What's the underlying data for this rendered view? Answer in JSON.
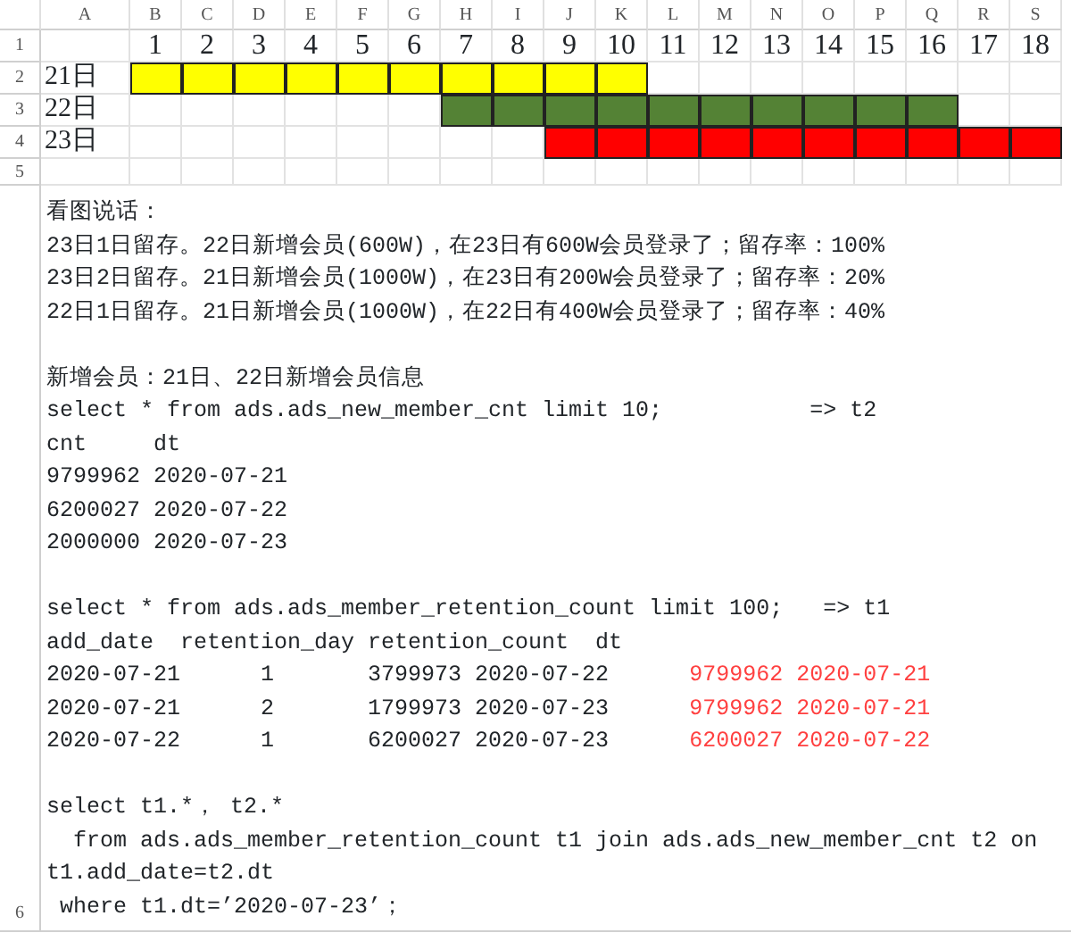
{
  "sheet": {
    "column_letters": [
      "A",
      "B",
      "C",
      "D",
      "E",
      "F",
      "G",
      "H",
      "I",
      "J",
      "K",
      "L",
      "M",
      "N",
      "O",
      "P",
      "Q",
      "R",
      "S"
    ],
    "row_numbers": [
      "1",
      "2",
      "3",
      "4",
      "5",
      "6"
    ],
    "day_numbers": [
      "1",
      "2",
      "3",
      "4",
      "5",
      "6",
      "7",
      "8",
      "9",
      "10",
      "11",
      "12",
      "13",
      "14",
      "15",
      "16",
      "17",
      "18"
    ],
    "rows": [
      {
        "label": "21日",
        "color": "#ffff00",
        "filled": [
          true,
          true,
          true,
          true,
          true,
          true,
          true,
          true,
          true,
          true,
          false,
          false,
          false,
          false,
          false,
          false,
          false,
          false
        ]
      },
      {
        "label": "22日",
        "color": "#548235",
        "filled": [
          false,
          false,
          false,
          false,
          false,
          false,
          true,
          true,
          true,
          true,
          true,
          true,
          true,
          true,
          true,
          true,
          false,
          false
        ]
      },
      {
        "label": "23日",
        "color": "#ff0000",
        "filled": [
          false,
          false,
          false,
          false,
          false,
          false,
          false,
          false,
          true,
          true,
          true,
          true,
          true,
          true,
          true,
          true,
          true,
          true
        ]
      }
    ],
    "note_blocks": [
      {
        "lines": [
          {
            "text": "看图说话："
          },
          {
            "text": "23日1日留存。22日新增会员(600W)，在23日有600W会员登录了；留存率：100%"
          },
          {
            "text": "23日2日留存。21日新增会员(1000W)，在23日有200W会员登录了；留存率：20%"
          },
          {
            "text": "22日1日留存。21日新增会员(1000W)，在22日有400W会员登录了；留存率：40%"
          }
        ]
      },
      {
        "lines": [
          {
            "text": "新增会员：21日、22日新增会员信息"
          },
          {
            "text": "select * from ads.ads_new_member_cnt limit 10;           => t2"
          },
          {
            "text": "cnt     dt"
          },
          {
            "text": "9799962 2020-07-21"
          },
          {
            "text": "6200027 2020-07-22"
          },
          {
            "text": "2000000 2020-07-23"
          }
        ]
      },
      {
        "lines": [
          {
            "text": "select * from ads.ads_member_retention_count limit 100;   => t1"
          },
          {
            "text": "add_date  retention_day retention_count  dt"
          },
          {
            "text": "2020-07-21      1       3799973 2020-07-22",
            "extra": {
              "text": "9799962 2020-07-21",
              "color": "#ff4040"
            }
          },
          {
            "text": "2020-07-21      2       1799973 2020-07-23",
            "extra": {
              "text": "9799962 2020-07-21",
              "color": "#ff4040"
            }
          },
          {
            "text": "2020-07-22      1       6200027 2020-07-23",
            "extra": {
              "text": "6200027 2020-07-22",
              "color": "#ff4040"
            }
          }
        ]
      },
      {
        "lines": [
          {
            "text": "select t1.*， t2.*"
          },
          {
            "text": "  from ads.ads_member_retention_count t1 join ads.ads_new_member_cnt t2 on"
          },
          {
            "text": "t1.add_date=t2.dt"
          },
          {
            "text": " where t1.dt=’2020-07-23’；"
          }
        ]
      }
    ]
  }
}
